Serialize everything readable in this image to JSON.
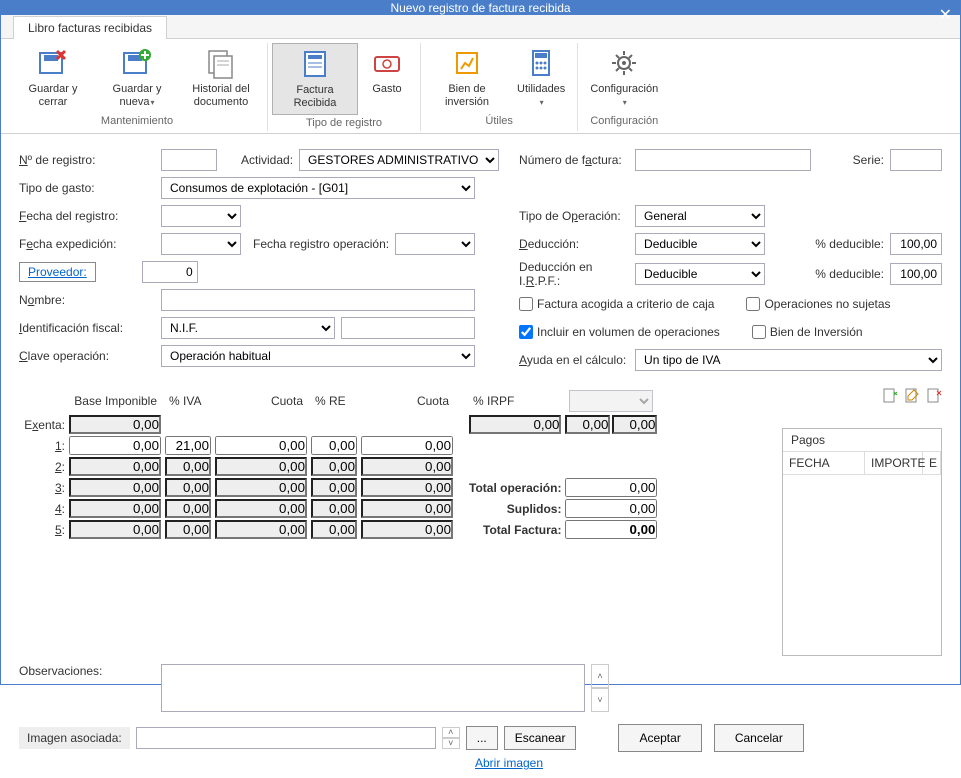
{
  "window": {
    "title": "Nuevo registro de factura recibida"
  },
  "tab": {
    "label": "Libro facturas recibidas"
  },
  "ribbon": {
    "guardar_cerrar": "Guardar y cerrar",
    "guardar_nueva": "Guardar y nueva",
    "historial": "Historial del documento",
    "factura_recibida": "Factura Recibida",
    "gasto": "Gasto",
    "bien_inversion": "Bien de inversión",
    "utilidades": "Utilidades",
    "configuracion": "Configuración",
    "grp_mantenimiento": "Mantenimiento",
    "grp_tipo_registro": "Tipo de registro",
    "grp_utiles": "Útiles",
    "grp_config": "Configuración"
  },
  "form": {
    "n_registro": "Nº de registro:",
    "actividad": "Actividad:",
    "actividad_val": "GESTORES ADMINISTRATIVOS",
    "tipo_gasto": "Tipo de gasto:",
    "tipo_gasto_val": "Consumos de explotación - [G01]",
    "fecha_registro": "Fecha del registro:",
    "fecha_expedicion": "Fecha expedición:",
    "fecha_reg_op": "Fecha registro operación:",
    "proveedor": "Proveedor:",
    "proveedor_val": "0",
    "nombre": "Nombre:",
    "id_fiscal": "Identificación fiscal:",
    "id_fiscal_val": "N.I.F.",
    "clave_op": "Clave operación:",
    "clave_op_val": "Operación habitual",
    "num_factura": "Número de factura:",
    "serie": "Serie:",
    "tipo_operacion": "Tipo de Operación:",
    "tipo_operacion_val": "General",
    "deduccion": "Deducción:",
    "deduccion_val": "Deducible",
    "pct_deducible": "% deducible:",
    "pct_ded_val1": "100,00",
    "deduccion_irpf": "Deducción en I.R.P.F.:",
    "deduccion_irpf_val": "Deducible",
    "pct_ded_val2": "100,00",
    "chk_caja": "Factura acogida a criterio de caja",
    "chk_no_sujetas": "Operaciones no sujetas",
    "chk_volumen": "Incluir en  volumen de operaciones",
    "chk_bien_inv": "Bien de Inversión",
    "ayuda_calculo": "Ayuda en el cálculo:",
    "ayuda_calculo_val": "Un tipo de IVA"
  },
  "grid": {
    "h_base": "Base Imponible",
    "h_iva": "% IVA",
    "h_cuota": "Cuota",
    "h_re": "% RE",
    "h_cuota2": "Cuota",
    "h_irpf": "% IRPF",
    "exenta": "Exenta:",
    "r1": "1:",
    "r2": "2:",
    "r3": "3:",
    "r4": "4:",
    "r5": "5:",
    "v000": "0,00",
    "v21": "21,00",
    "tot_op": "Total operación:",
    "suplidos": "Suplidos:",
    "tot_factura": "Total Factura:"
  },
  "pagos": {
    "title": "Pagos",
    "h_fecha": "FECHA",
    "h_importe": "IMPORTE",
    "h_e": "E"
  },
  "bottom": {
    "observaciones": "Observaciones:",
    "imagen": "Imagen asociada:",
    "browse": "...",
    "escanear": "Escanear",
    "abrir_imagen": "Abrir imagen",
    "aceptar": "Aceptar",
    "cancelar": "Cancelar"
  }
}
